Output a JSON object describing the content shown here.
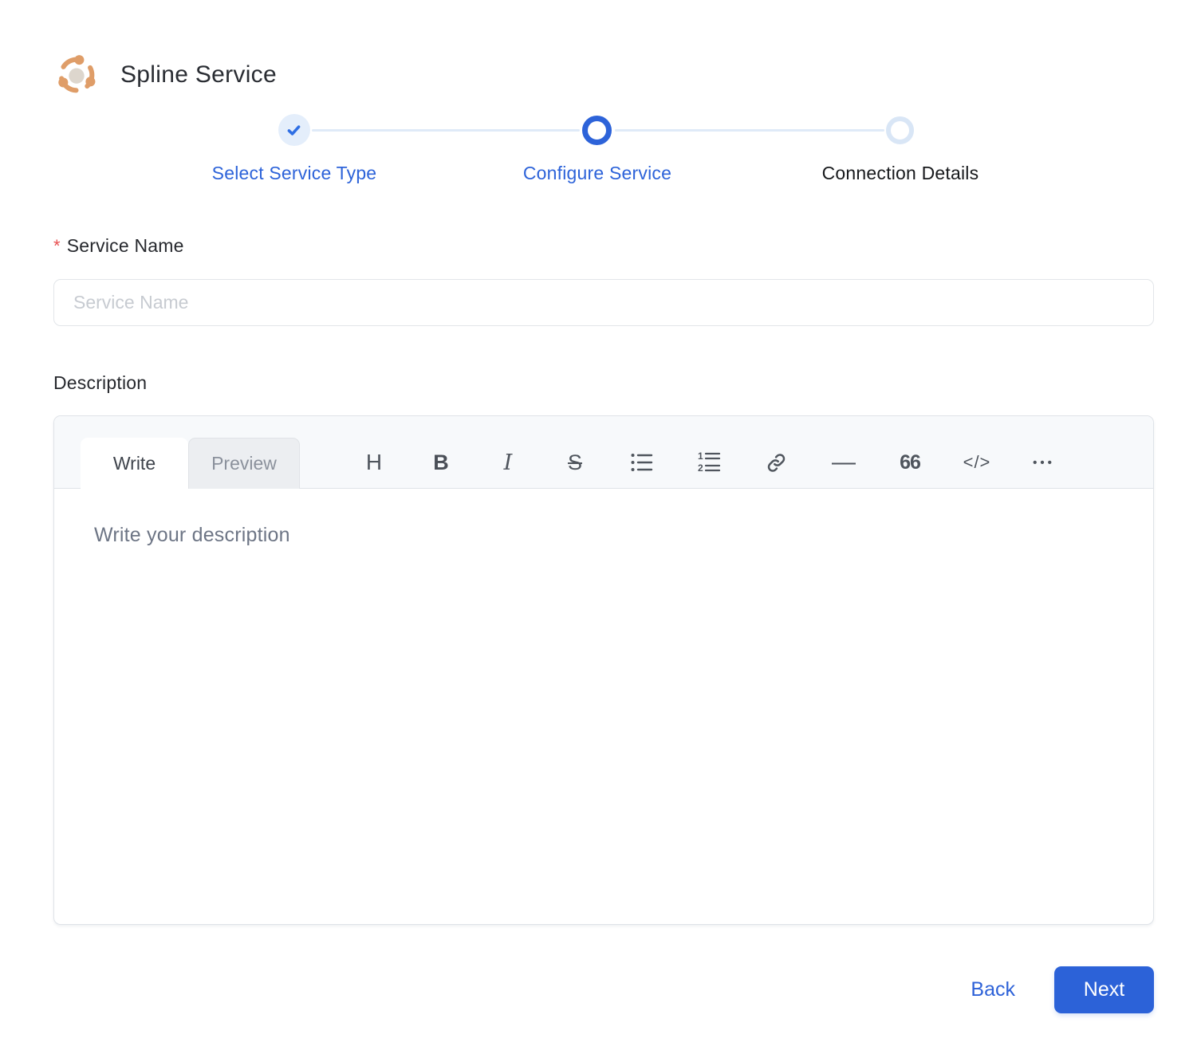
{
  "header": {
    "title": "Spline Service",
    "logo_icon": "spline-network-icon"
  },
  "stepper": {
    "steps": [
      {
        "label": "Select Service Type",
        "state": "completed"
      },
      {
        "label": "Configure Service",
        "state": "active"
      },
      {
        "label": "Connection Details",
        "state": "upcoming"
      }
    ]
  },
  "form": {
    "service_name": {
      "required_marker": "*",
      "label": "Service Name",
      "placeholder": "Service Name",
      "value": ""
    },
    "description": {
      "label": "Description",
      "editor": {
        "tabs": [
          {
            "label": "Write",
            "active": true
          },
          {
            "label": "Preview",
            "active": false
          }
        ],
        "toolbar": [
          {
            "name": "heading",
            "glyph": "H"
          },
          {
            "name": "bold",
            "glyph": "B"
          },
          {
            "name": "italic",
            "glyph": "I"
          },
          {
            "name": "strikethrough",
            "glyph": "S"
          },
          {
            "name": "unordered-list",
            "glyph": ""
          },
          {
            "name": "ordered-list",
            "glyph": ""
          },
          {
            "name": "link",
            "glyph": ""
          },
          {
            "name": "horizontal-rule",
            "glyph": "—"
          },
          {
            "name": "quote",
            "glyph": "66"
          },
          {
            "name": "code",
            "glyph": "</>"
          },
          {
            "name": "more",
            "glyph": "•••"
          }
        ],
        "placeholder": "Write your description",
        "value": ""
      }
    }
  },
  "footer": {
    "back_label": "Back",
    "next_label": "Next"
  },
  "colors": {
    "accent_blue": "#2d63d9",
    "accent_blue_light": "#e4eefb",
    "connector_blue": "#dfeaf8",
    "brand_orange": "#df9d68",
    "required_red": "#e85051",
    "next_button_bg": "#2c62d8"
  }
}
